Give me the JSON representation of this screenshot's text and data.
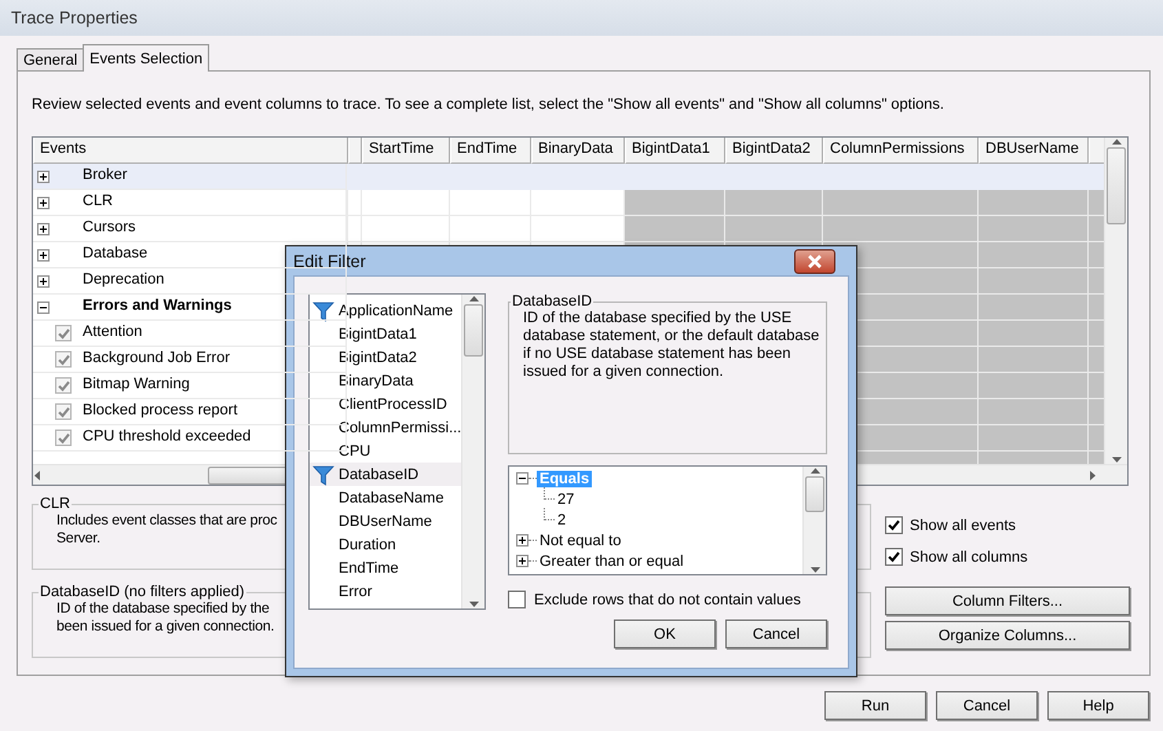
{
  "window": {
    "title": "Trace Properties"
  },
  "tabs": [
    {
      "label": "General",
      "selected": false
    },
    {
      "label": "Events Selection",
      "selected": true
    }
  ],
  "instructions": "Review selected events and event columns to trace. To see a complete list, select the \"Show all events\" and \"Show all columns\" options.",
  "grid": {
    "columns": [
      {
        "label": "Events",
        "shaded": false
      },
      {
        "label": "StartTime",
        "shaded": false
      },
      {
        "label": "EndTime",
        "shaded": false
      },
      {
        "label": "BinaryData",
        "shaded": false
      },
      {
        "label": "BigintData1",
        "shaded": true
      },
      {
        "label": "BigintData2",
        "shaded": true
      },
      {
        "label": "ColumnPermissions",
        "shaded": true
      },
      {
        "label": "DBUserName",
        "shaded": true
      }
    ],
    "rows": [
      {
        "label": "Broker",
        "kind": "category",
        "expanded": false,
        "selected": true
      },
      {
        "label": "CLR",
        "kind": "category",
        "expanded": false,
        "selected": false
      },
      {
        "label": "Cursors",
        "kind": "category",
        "expanded": false,
        "selected": false
      },
      {
        "label": "Database",
        "kind": "category",
        "expanded": false,
        "selected": false
      },
      {
        "label": "Deprecation",
        "kind": "category",
        "expanded": false,
        "selected": false
      },
      {
        "label": "Errors and Warnings",
        "kind": "category",
        "expanded": true,
        "selected": false
      },
      {
        "label": "Attention",
        "kind": "event",
        "checked": true,
        "selected": false
      },
      {
        "label": "Background Job Error",
        "kind": "event",
        "checked": true,
        "selected": false
      },
      {
        "label": "Bitmap Warning",
        "kind": "event",
        "checked": true,
        "selected": false
      },
      {
        "label": "Blocked process report",
        "kind": "event",
        "checked": true,
        "selected": false
      },
      {
        "label": "CPU threshold exceeded",
        "kind": "event",
        "checked": true,
        "selected": false
      }
    ]
  },
  "groups": [
    {
      "title": "CLR",
      "lines": [
        "Includes event classes that are proc",
        "Server."
      ]
    },
    {
      "title": "DatabaseID (no filters applied)",
      "lines": [
        "ID of the database specified by the",
        "been issued for a given connection."
      ]
    }
  ],
  "options": [
    {
      "label": "Show all events",
      "checked": true
    },
    {
      "label": "Show all columns",
      "checked": true
    }
  ],
  "side_buttons": [
    "Column Filters...",
    "Organize Columns..."
  ],
  "buttons": [
    "Run",
    "Cancel",
    "Help"
  ],
  "edit_filter": {
    "title": "Edit Filter",
    "columns": [
      {
        "label": "ApplicationName",
        "filtered": true,
        "selected": false
      },
      {
        "label": "BigintData1",
        "filtered": false,
        "selected": false
      },
      {
        "label": "BigintData2",
        "filtered": false,
        "selected": false
      },
      {
        "label": "BinaryData",
        "filtered": false,
        "selected": false
      },
      {
        "label": "ClientProcessID",
        "filtered": false,
        "selected": false
      },
      {
        "label": "ColumnPermissi...",
        "filtered": false,
        "selected": false
      },
      {
        "label": "CPU",
        "filtered": false,
        "selected": false
      },
      {
        "label": "DatabaseID",
        "filtered": true,
        "selected": true
      },
      {
        "label": "DatabaseName",
        "filtered": false,
        "selected": false
      },
      {
        "label": "DBUserName",
        "filtered": false,
        "selected": false
      },
      {
        "label": "Duration",
        "filtered": false,
        "selected": false
      },
      {
        "label": "EndTime",
        "filtered": false,
        "selected": false
      },
      {
        "label": "Error",
        "filtered": false,
        "selected": false
      }
    ],
    "description": {
      "title": "DatabaseID",
      "text": "ID of the database specified by the USE database statement, or the default database if no USE database statement has been issued for a given connection."
    },
    "operators": [
      {
        "label": "Equals",
        "expanded": true,
        "selected": true,
        "children": [
          {
            "label": "27"
          },
          {
            "label": "2"
          }
        ]
      },
      {
        "label": "Not equal to",
        "expanded": false,
        "selected": false
      },
      {
        "label": "Greater than or equal",
        "expanded": false,
        "selected": false
      }
    ],
    "exclude_rows": {
      "label": "Exclude rows that do not contain values",
      "checked": false
    },
    "buttons": [
      "OK",
      "Cancel"
    ]
  }
}
